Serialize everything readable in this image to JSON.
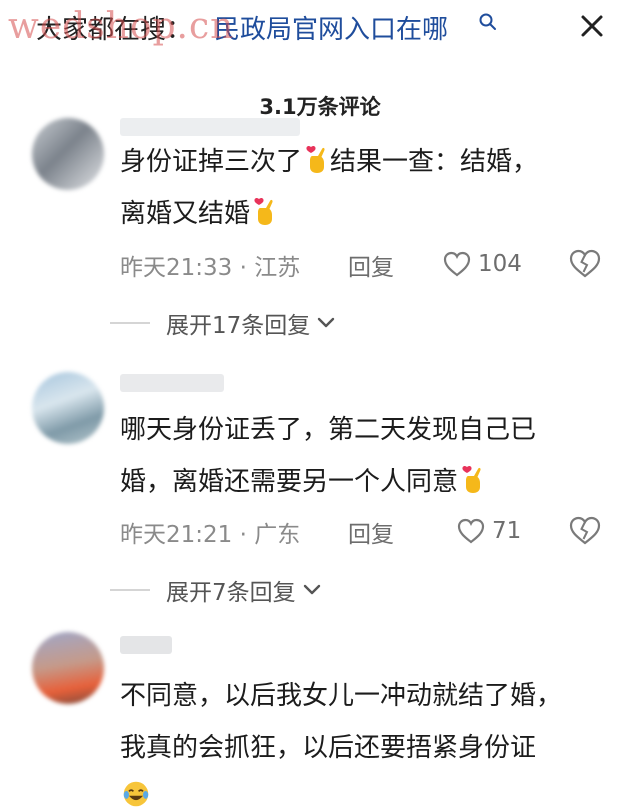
{
  "header": {
    "search_prefix": "大家都在搜：",
    "search_query": "民政局官网入口在哪",
    "watermark": "wedshop.cn",
    "close_icon": "close-icon",
    "search_icon": "search-icon"
  },
  "comments_header": {
    "count_label": "3.1万条评论"
  },
  "comments": [
    {
      "text_line1": "身份证掉三次了",
      "text_line2_a": "结果一查：结婚，",
      "text_line2": "离婚又结婚",
      "time_location": "昨天21:33 · 江苏",
      "reply_label": "回复",
      "like_count": "104",
      "expand_label": "展开17条回复"
    },
    {
      "text_line1": "哪天身份证丢了，第二天发现自己已",
      "text_line2": "婚，离婚还需要另一个人同意",
      "time_location": "昨天21:21 · 广东",
      "reply_label": "回复",
      "like_count": "71",
      "expand_label": "展开7条回复"
    },
    {
      "text_line1": "不同意，以后我女儿一冲动就结了婚，",
      "text_line2": "我真的会抓狂，以后还要捂紧身份证"
    }
  ],
  "colors": {
    "search_query": "#1f4d9c",
    "meta_gray": "#8a8a8a",
    "heart_emoji": "#e8335a",
    "hand_emoji": "#f5b81a"
  }
}
